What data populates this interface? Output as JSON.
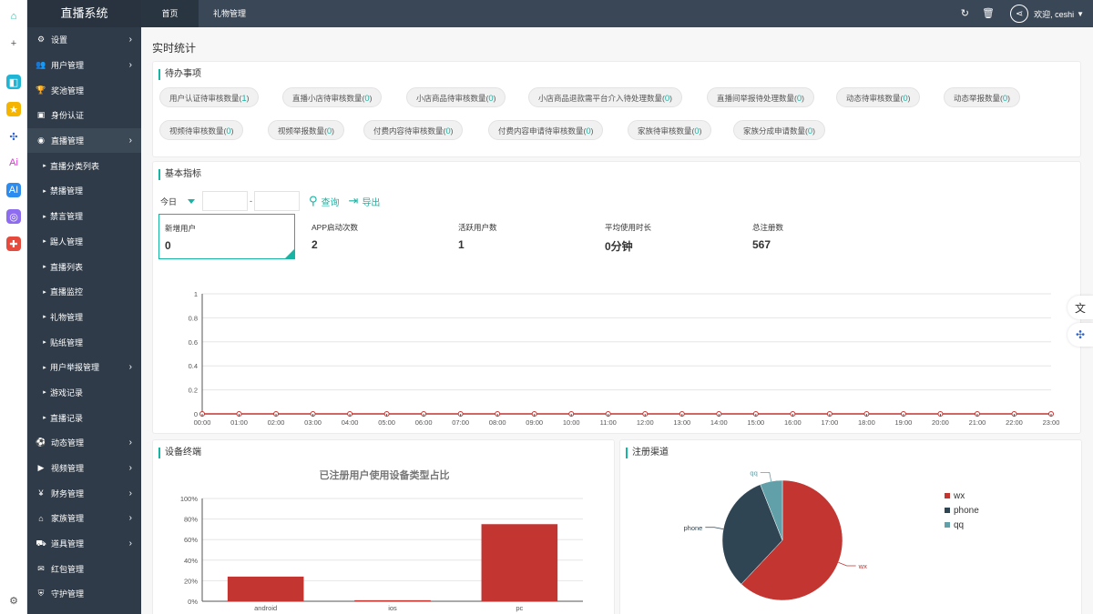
{
  "app": {
    "brand": "直播系统"
  },
  "sidebar": {
    "items": [
      {
        "label": "设置",
        "icon": "gears-icon",
        "glyph": "⚙",
        "chev": true
      },
      {
        "label": "用户管理",
        "icon": "users-icon",
        "glyph": "👥",
        "chev": true
      },
      {
        "label": "奖池管理",
        "icon": "trophy-icon",
        "glyph": "🏆",
        "chev": false
      },
      {
        "label": "身份认证",
        "icon": "id-card-icon",
        "glyph": "▣",
        "chev": false
      },
      {
        "label": "直播管理",
        "icon": "eye-icon",
        "glyph": "◉",
        "chev": true,
        "active": true
      },
      {
        "label": "直播分类列表",
        "sub": true
      },
      {
        "label": "禁播管理",
        "sub": true
      },
      {
        "label": "禁言管理",
        "sub": true
      },
      {
        "label": "踢人管理",
        "sub": true
      },
      {
        "label": "直播列表",
        "sub": true
      },
      {
        "label": "直播监控",
        "sub": true
      },
      {
        "label": "礼物管理",
        "sub": true
      },
      {
        "label": "贴纸管理",
        "sub": true
      },
      {
        "label": "用户举报管理",
        "sub": true,
        "chev": true
      },
      {
        "label": "游戏记录",
        "sub": true
      },
      {
        "label": "直播记录",
        "sub": true
      },
      {
        "label": "动态管理",
        "icon": "soccer-icon",
        "glyph": "⚽",
        "chev": true
      },
      {
        "label": "视频管理",
        "icon": "video-camera-icon",
        "glyph": "▶",
        "chev": true
      },
      {
        "label": "财务管理",
        "icon": "yen-icon",
        "glyph": "¥",
        "chev": true
      },
      {
        "label": "家族管理",
        "icon": "family-icon",
        "glyph": "⌂",
        "chev": true
      },
      {
        "label": "道具管理",
        "icon": "motorcycle-icon",
        "glyph": "⛟",
        "chev": true
      },
      {
        "label": "红包管理",
        "icon": "envelope-icon",
        "glyph": "✉",
        "chev": false
      },
      {
        "label": "守护管理",
        "icon": "shield-icon",
        "glyph": "⛨",
        "chev": false
      }
    ]
  },
  "rail": [
    {
      "icon": "home-icon",
      "glyph": "⌂",
      "color": "#17b3a3",
      "bg": "transparent"
    },
    {
      "icon": "plus-icon",
      "glyph": "+",
      "color": "#555",
      "bg": "transparent"
    },
    {
      "icon": "app-teal-icon",
      "glyph": "◧",
      "color": "#fff",
      "bg": "#1fb6d6"
    },
    {
      "icon": "star-app-icon",
      "glyph": "★",
      "color": "#fff",
      "bg": "#f5b400"
    },
    {
      "icon": "network-app-icon",
      "glyph": "✣",
      "color": "#2a61d6",
      "bg": "transparent"
    },
    {
      "icon": "ai-ring-icon",
      "glyph": "Ai",
      "color": "#d63ad0",
      "bg": "transparent"
    },
    {
      "icon": "ai-blue-icon",
      "glyph": "AI",
      "color": "#fff",
      "bg": "#2d8cf0"
    },
    {
      "icon": "bot-icon",
      "glyph": "◎",
      "color": "#fff",
      "bg": "#8e6cf0"
    },
    {
      "icon": "gamepad-icon",
      "glyph": "✚",
      "color": "#fff",
      "bg": "#e64a3c"
    }
  ],
  "topbar": {
    "tabs": [
      {
        "label": "首页",
        "active": true
      },
      {
        "label": "礼物管理",
        "active": false
      }
    ],
    "greeting": "欢迎, ceshi"
  },
  "main": {
    "title": "实时统计",
    "todo": {
      "title": "待办事项",
      "row1": [
        {
          "label": "用户认证待审核数量(",
          "count": "1",
          "end": ")"
        },
        {
          "label": "直播小店待审核数量(",
          "count": "0",
          "end": ")"
        },
        {
          "label": "小店商品待审核数量(",
          "count": "0",
          "end": ")"
        },
        {
          "label": "小店商品退款需平台介入待处理数量(",
          "count": "0",
          "end": ")"
        },
        {
          "label": "直播间举报待处理数量(",
          "count": "0",
          "end": ")"
        },
        {
          "label": "动态待审核数量(",
          "count": "0",
          "end": ")"
        },
        {
          "label": "动态举报数量(",
          "count": "0",
          "end": ")"
        }
      ],
      "row2": [
        {
          "label": "视频待审核数量(",
          "count": "0",
          "end": ")"
        },
        {
          "label": "视频举报数量(",
          "count": "0",
          "end": ")"
        },
        {
          "label": "付费内容待审核数量(",
          "count": "0",
          "end": ")"
        },
        {
          "label": "付费内容申请待审核数量(",
          "count": "0",
          "end": ")"
        },
        {
          "label": "家族待审核数量(",
          "count": "0",
          "end": ")"
        },
        {
          "label": "家族分成申请数量(",
          "count": "0",
          "end": ")"
        }
      ]
    },
    "basic": {
      "title": "基本指标",
      "filter": {
        "range": "今日",
        "separator": "-",
        "query": "查询",
        "export": "导出"
      },
      "stats": [
        {
          "label": "新增用户",
          "value": "0",
          "selected": true
        },
        {
          "label": "APP启动次数",
          "value": "2"
        },
        {
          "label": "活跃用户数",
          "value": "1"
        },
        {
          "label": "平均使用时长",
          "value": "0分钟"
        },
        {
          "label": "总注册数",
          "value": "567"
        }
      ]
    },
    "device": {
      "title": "设备终端",
      "chart_title": "已注册用户使用设备类型占比"
    },
    "channel": {
      "title": "注册渠道"
    }
  },
  "chart_data": [
    {
      "type": "line",
      "x": [
        "00:00",
        "01:00",
        "02:00",
        "03:00",
        "04:00",
        "05:00",
        "06:00",
        "07:00",
        "08:00",
        "09:00",
        "10:00",
        "11:00",
        "12:00",
        "13:00",
        "14:00",
        "15:00",
        "16:00",
        "17:00",
        "18:00",
        "19:00",
        "20:00",
        "21:00",
        "22:00",
        "23:00"
      ],
      "series": [
        {
          "values": [
            0,
            0,
            0,
            0,
            0,
            0,
            0,
            0,
            0,
            0,
            0,
            0,
            0,
            0,
            0,
            0,
            0,
            0,
            0,
            0,
            0,
            0,
            0,
            0
          ]
        }
      ],
      "ylim": [
        0,
        1
      ],
      "yticks": [
        "0",
        "0.2",
        "0.4",
        "0.6",
        "0.8",
        "1"
      ],
      "color": "#c23531",
      "grid": true
    },
    {
      "type": "bar",
      "title": "已注册用户使用设备类型占比",
      "categories": [
        "android",
        "ios",
        "pc"
      ],
      "values": [
        24,
        1,
        75
      ],
      "ylim": [
        0,
        100
      ],
      "yticks": [
        "0%",
        "20%",
        "40%",
        "60%",
        "80%",
        "100%"
      ],
      "color": "#c23531"
    },
    {
      "type": "pie",
      "labels": [
        "wx",
        "phone",
        "qq"
      ],
      "values": [
        62,
        32,
        6
      ],
      "colors": [
        "#c23531",
        "#2f4554",
        "#61a0a8"
      ],
      "legend": "right"
    }
  ]
}
